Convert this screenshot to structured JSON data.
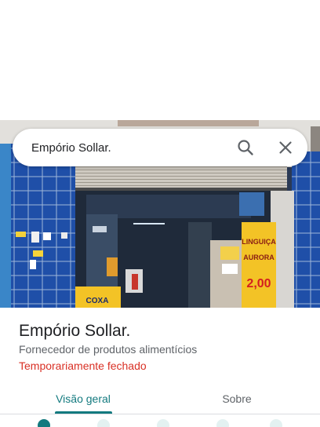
{
  "search": {
    "query": "Empório Sollar."
  },
  "place": {
    "name": "Empório Sollar.",
    "category": "Fornecedor de produtos alimentícios",
    "status": "Temporariamente fechado"
  },
  "tabs": [
    {
      "label": "Visão geral",
      "selected": true
    },
    {
      "label": "Sobre",
      "selected": false
    }
  ],
  "photo": {
    "signs": {
      "coxa": "COXA",
      "linguica": "LINGUIÇA",
      "aurora": "AURORA",
      "price": "2,00"
    }
  },
  "icons": {
    "search": "search-icon",
    "close": "close-icon"
  },
  "colors": {
    "accent": "#137a7f",
    "status_closed": "#d93025",
    "tile_blue": "#1f4fa8"
  }
}
